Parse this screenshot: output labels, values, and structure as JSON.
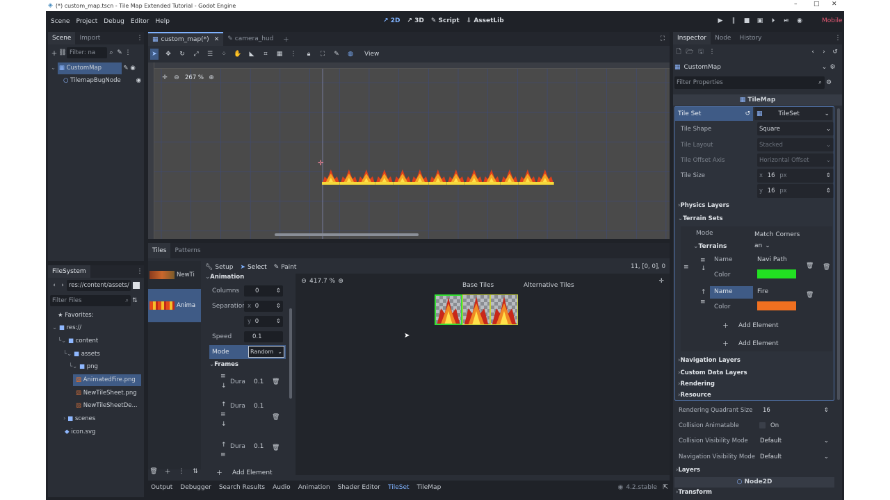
{
  "window": {
    "title": "(*) custom_map.tscn - Tile Map Extended Tutorial - Godot Engine"
  },
  "menu": [
    "Scene",
    "Project",
    "Debug",
    "Editor",
    "Help"
  ],
  "modes": [
    {
      "label": "2D",
      "icon": "2d-icon",
      "active": true
    },
    {
      "label": "3D",
      "icon": "3d-icon",
      "active": false
    },
    {
      "label": "Script",
      "icon": "script-icon",
      "active": false
    },
    {
      "label": "AssetLib",
      "icon": "assetlib-icon",
      "active": false
    }
  ],
  "renderer": "Mobile",
  "scene_dock": {
    "tabs": [
      "Scene",
      "Import"
    ],
    "filter_placeholder": "Filter: na",
    "nodes": [
      {
        "label": "CustomMap",
        "selected": true
      },
      {
        "label": "TilemapBugNode",
        "selected": false
      }
    ]
  },
  "filesystem": {
    "tab": "FileSystem",
    "path": "res://content/assets/",
    "filter_placeholder": "Filter Files",
    "items": [
      {
        "label": "Favorites:",
        "type": "favorites"
      },
      {
        "label": "res://",
        "type": "folder"
      },
      {
        "label": "content",
        "type": "folder"
      },
      {
        "label": "assets",
        "type": "folder"
      },
      {
        "label": "png",
        "type": "folder"
      },
      {
        "label": "AnimatedFire.png",
        "type": "file",
        "selected": true
      },
      {
        "label": "NewTileSheet.png",
        "type": "file"
      },
      {
        "label": "NewTileSheetDe...",
        "type": "file"
      },
      {
        "label": "scenes",
        "type": "folder"
      },
      {
        "label": "icon.svg",
        "type": "file"
      }
    ]
  },
  "editor_tabs": [
    {
      "label": "custom_map(*)",
      "active": true
    },
    {
      "label": "camera_hud",
      "active": false
    }
  ],
  "toolbar": {
    "view_label": "View"
  },
  "viewport": {
    "zoom": "267 %",
    "fire_tiles": 13
  },
  "tileset_panel": {
    "tabs": [
      "Tiles",
      "Patterns"
    ],
    "sources": [
      {
        "label": "NewTi"
      },
      {
        "label": "Anima"
      }
    ],
    "modes": [
      "Setup",
      "Select",
      "Paint"
    ],
    "coords": "11, [0, 0], 0",
    "animation_label": "Animation",
    "columns_label": "Columns",
    "columns_value": "0",
    "separation_label": "Separation",
    "sep_x": "0",
    "sep_y": "0",
    "speed_label": "Speed",
    "speed_value": "0.1",
    "mode_label": "Mode",
    "mode_value": "Random",
    "frames_label": "Frames",
    "frames": [
      {
        "label": "Dura",
        "value": "0.1"
      },
      {
        "label": "Dura",
        "value": "0.1"
      },
      {
        "label": "Dura",
        "value": "0.1"
      }
    ],
    "add_element": "Add Element",
    "atlas_zoom": "417.7 %",
    "base_tiles_label": "Base Tiles",
    "alt_tiles_label": "Alternative Tiles"
  },
  "bottom_tabs": [
    "Output",
    "Debugger",
    "Search Results",
    "Audio",
    "Animation",
    "Shader Editor",
    "TileSet",
    "TileMap"
  ],
  "active_bottom_tab": "TileSet",
  "version": "4.2.stable",
  "inspector": {
    "tabs": [
      "Inspector",
      "Node",
      "History"
    ],
    "object": "CustomMap",
    "filter_placeholder": "Filter Properties",
    "category": "TileMap",
    "tile_set_label": "Tile Set",
    "tile_set_value": "TileSet",
    "rows": [
      {
        "label": "Tile Shape",
        "value": "Square",
        "disabled": false
      },
      {
        "label": "Tile Layout",
        "value": "Stacked",
        "disabled": true
      },
      {
        "label": "Tile Offset Axis",
        "value": "Horizontal Offset",
        "disabled": true
      }
    ],
    "tile_size_label": "Tile Size",
    "tile_size_x": "16",
    "tile_size_y": "16",
    "px_unit": "px",
    "physics_layers": "Physics Layers",
    "terrain_sets": "Terrain Sets",
    "terrain_mode_label": "Mode",
    "terrain_mode_value": "Match Corners an",
    "terrains_label": "Terrains",
    "terrains": [
      {
        "name_label": "Name",
        "name": "Navi Path",
        "color_label": "Color",
        "color": "#22e022"
      },
      {
        "name_label": "Name",
        "name": "Fire",
        "color_label": "Color",
        "color": "#f07020"
      }
    ],
    "add_element": "Add Element",
    "sections": [
      "Navigation Layers",
      "Custom Data Layers",
      "Rendering",
      "Resource"
    ],
    "quadrant_label": "Rendering Quadrant Size",
    "quadrant_value": "16",
    "collision_anim_label": "Collision Animatable",
    "collision_anim_value": "On",
    "collision_vis_label": "Collision Visibility Mode",
    "collision_vis_value": "Default",
    "nav_vis_label": "Navigation Visibility Mode",
    "nav_vis_value": "Default",
    "layers_label": "Layers",
    "node2d_label": "Node2D",
    "transform_label": "Transform"
  },
  "colors": {
    "accent": "#7fb2ff",
    "selection": "#3f5b86",
    "panel": "#2a2e36",
    "background": "#1f2228"
  }
}
